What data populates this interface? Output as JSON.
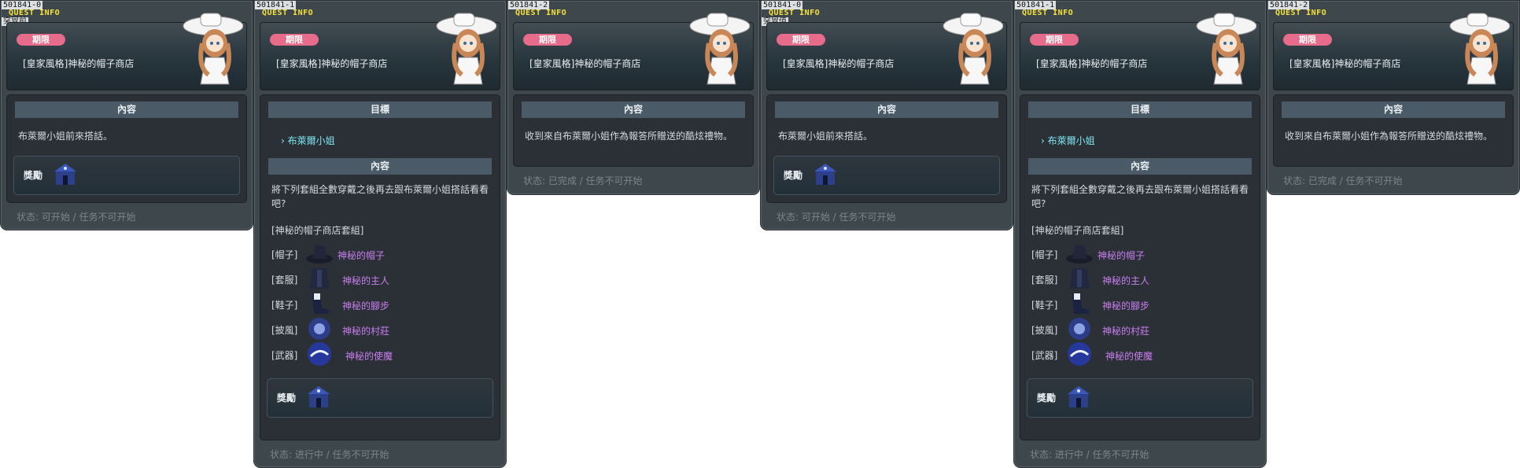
{
  "panels": [
    {
      "id": "501841-0",
      "sub": "突冒前",
      "header": "QUEST INFO",
      "badge": "期限",
      "title": "[皇家風格]神秘的帽子商店",
      "section": "內容",
      "text": "布萊爾小姐前來搭話。",
      "reward_label": "獎勵",
      "status": "状态: 可开始 / 任务不可开始"
    },
    {
      "id": "501841-1",
      "header": "QUEST INFO",
      "badge": "期限",
      "title": "[皇家風格]神秘的帽子商店",
      "target_head": "目標",
      "target": "布萊爾小姐",
      "section": "內容",
      "text": "將下列套組全數穿戴之後再去跟布萊爾小姐搭話看看吧?",
      "set_name": "[神秘的帽子商店套組]",
      "items": [
        {
          "slot": "[帽子]",
          "name": "神秘的帽子"
        },
        {
          "slot": "[套服]",
          "name": "神秘的主人"
        },
        {
          "slot": "[鞋子]",
          "name": "神秘的腳步"
        },
        {
          "slot": "[披風]",
          "name": "神秘的村莊"
        },
        {
          "slot": "[武器]",
          "name": "神秘的使魔"
        }
      ],
      "reward_label": "獎勵",
      "status": "状态: 进行中 / 任务不可开始"
    },
    {
      "id": "501841-2",
      "header": "QUEST INFO",
      "badge": "期限",
      "title": "[皇家風格]神秘的帽子商店",
      "section": "內容",
      "text": "收到來自布萊爾小姐作為報答所贈送的酷炫禮物。",
      "status": "状态: 已完成 / 任务不可开始"
    },
    {
      "id": "501841-0",
      "sub": "突冒值",
      "header": "QUEST INFO",
      "badge": "期限",
      "title": "[皇家風格]神秘的帽子商店",
      "section": "內容",
      "text": "布萊爾小姐前來搭話。",
      "reward_label": "獎勵",
      "status": "状态: 可开始 / 任务不可开始"
    },
    {
      "id": "501841-1",
      "header": "QUEST INFO",
      "badge": "期限",
      "title": "[皇家風格]神秘的帽子商店",
      "target_head": "目標",
      "target": "布萊爾小姐",
      "section": "內容",
      "text": "將下列套組全數穿戴之後再去跟布萊爾小姐搭話看看吧?",
      "set_name": "[神秘的帽子商店套組]",
      "items": [
        {
          "slot": "[帽子]",
          "name": "神秘的帽子"
        },
        {
          "slot": "[套服]",
          "name": "神秘的主人"
        },
        {
          "slot": "[鞋子]",
          "name": "神秘的腳步"
        },
        {
          "slot": "[披風]",
          "name": "神秘的村莊"
        },
        {
          "slot": "[武器]",
          "name": "神秘的使魔"
        }
      ],
      "reward_label": "獎勵",
      "status": "状态: 进行中 / 任务不可开始"
    },
    {
      "id": "501841-2",
      "header": "QUEST INFO",
      "badge": "期限",
      "title": "[皇家風格]神秘的帽子商店",
      "section": "內容",
      "text": "收到來自布萊爾小姐作為報答所贈送的酷炫禮物。",
      "status": "状态: 已完成 / 任务不可开始"
    }
  ],
  "colors": {
    "badge": "#e76c8c",
    "header_text": "#f7e33a",
    "target": "#7ee6f0",
    "item_name": "#c97ef0"
  },
  "icons": {
    "portrait": "npc-blair-portrait-icon",
    "reward": "mystery-hat-box-icon"
  }
}
